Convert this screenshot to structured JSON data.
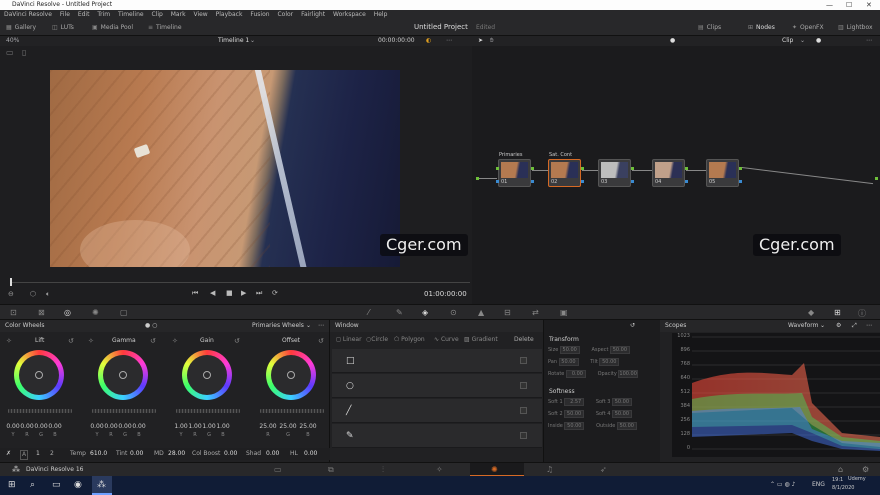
{
  "window": {
    "title": "DaVinci Resolve - Untitled Project"
  },
  "menu": [
    "DaVinci Resolve",
    "File",
    "Edit",
    "Trim",
    "Timeline",
    "Clip",
    "Mark",
    "View",
    "Playback",
    "Fusion",
    "Color",
    "Fairlight",
    "Workspace",
    "Help"
  ],
  "toolbar": {
    "gallery": "Gallery",
    "luts": "LUTs",
    "media_pool": "Media Pool",
    "timeline": "Timeline",
    "project_title": "Untitled Project",
    "edited": "Edited",
    "clips": "Clips",
    "nodes": "Nodes",
    "openfx": "OpenFX",
    "lightbox": "Lightbox"
  },
  "viewer": {
    "zoom": "40%",
    "timeline_name": "Timeline 1",
    "timecode": "00:00:00:00",
    "clip_mode": "Clip",
    "play_timecode": "01:00:00:00"
  },
  "nodes": [
    {
      "label": "Primaries",
      "num": "01"
    },
    {
      "label": "Sat. Cont",
      "num": "02"
    },
    {
      "label": "",
      "num": "03"
    },
    {
      "label": "",
      "num": "04"
    },
    {
      "label": "",
      "num": "05"
    }
  ],
  "watermark": "Cger.com",
  "color_wheels": {
    "title": "Color Wheels",
    "mode": "Primaries Wheels",
    "wheels": [
      {
        "name": "Lift",
        "values": [
          "0.00",
          "0.00",
          "0.00",
          "0.00"
        ],
        "channels": [
          "Y",
          "R",
          "G",
          "B"
        ]
      },
      {
        "name": "Gamma",
        "values": [
          "0.00",
          "0.00",
          "0.00",
          "0.00"
        ],
        "channels": [
          "Y",
          "R",
          "G",
          "B"
        ]
      },
      {
        "name": "Gain",
        "values": [
          "1.00",
          "1.00",
          "1.00",
          "1.00"
        ],
        "channels": [
          "Y",
          "R",
          "G",
          "B"
        ]
      },
      {
        "name": "Offset",
        "values": [
          "25.00",
          "25.00",
          "25.00"
        ],
        "channels": [
          "R",
          "G",
          "B"
        ]
      }
    ],
    "params": {
      "page1": "1",
      "page2": "2",
      "temp_label": "Temp",
      "temp": "610.0",
      "tint_label": "Tint",
      "tint": "0.00",
      "md_label": "MD",
      "md": "28.00",
      "colboost_label": "Col Boost",
      "colboost": "0.00",
      "shad_label": "Shad",
      "shad": "0.00",
      "hl_label": "HL",
      "hl": "0.00"
    }
  },
  "window_panel": {
    "title": "Window",
    "linear": "Linear",
    "circle": "Circle",
    "polygon": "Polygon",
    "curve": "Curve",
    "gradient": "Gradient",
    "delete": "Delete"
  },
  "transform": {
    "title": "Transform",
    "size_l": "Size",
    "size": "50.00",
    "pan_l": "Pan",
    "pan": "50.00",
    "rotate_l": "Rotate",
    "rotate": "0.00",
    "aspect_l": "Aspect",
    "aspect": "50.00",
    "tilt_l": "Tilt",
    "tilt": "50.00",
    "opacity_l": "Opacity",
    "opacity": "100.00"
  },
  "softness": {
    "title": "Softness",
    "s1_l": "Soft 1",
    "s1": "2.57",
    "s2_l": "Soft 2",
    "s2": "50.00",
    "in_l": "Inside",
    "in": "50.00",
    "s3_l": "Soft 3",
    "s3": "50.00",
    "s4_l": "Soft 4",
    "s4": "50.00",
    "out_l": "Outside",
    "out": "50.00"
  },
  "scopes": {
    "title": "Scopes",
    "mode": "Waveform",
    "ticks": [
      "1023",
      "896",
      "768",
      "640",
      "512",
      "384",
      "256",
      "128",
      "0"
    ]
  },
  "page_bar": {
    "app": "DaVinci Resolve 16"
  },
  "taskbar": {
    "lang": "ENG",
    "time": "19:1",
    "date": "8/1/2020",
    "user": "Udemy"
  }
}
